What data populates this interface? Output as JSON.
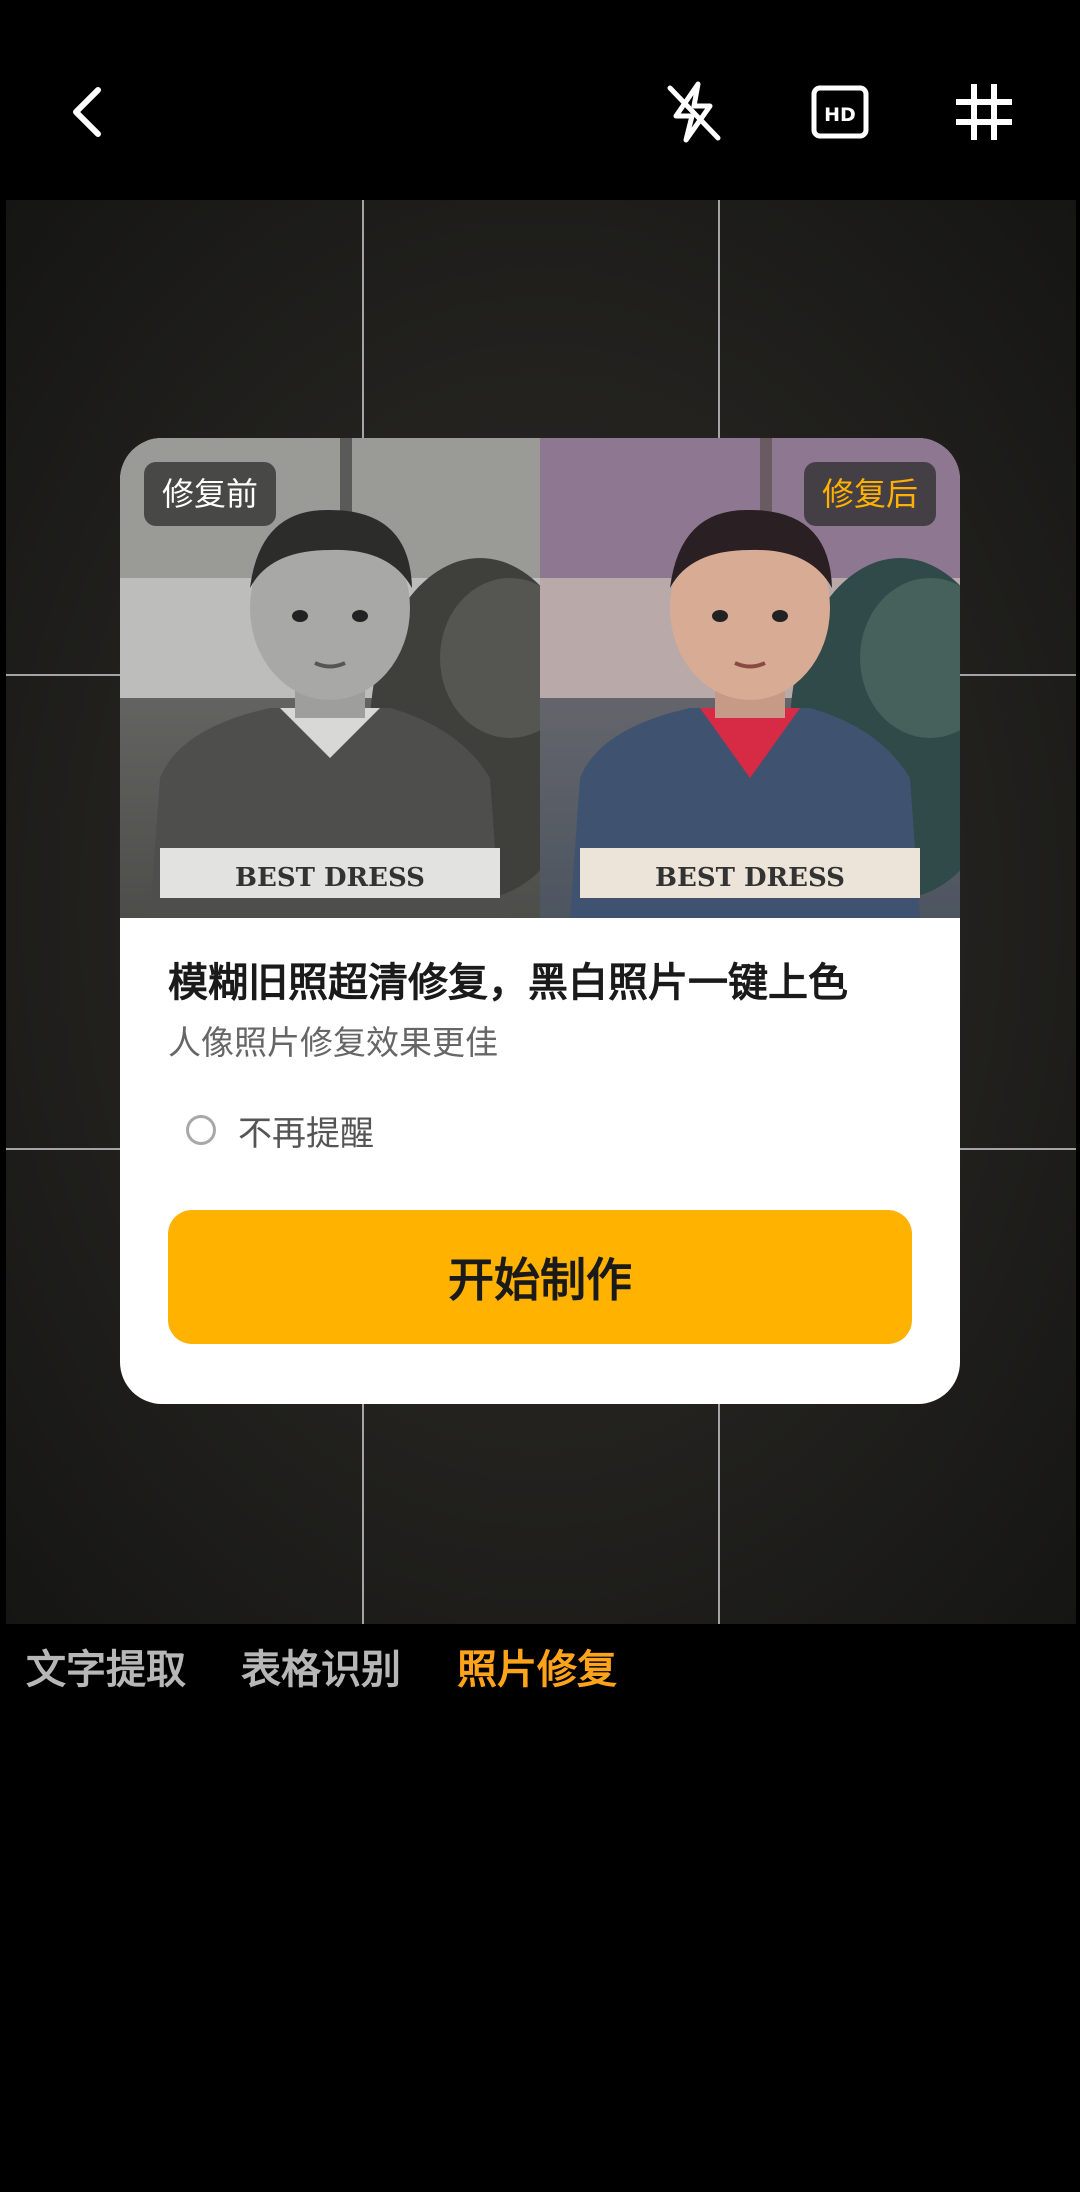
{
  "topbar": {
    "back_icon": "chevron-left-icon",
    "flash_icon": "flash-off-icon",
    "hd_icon": "hd-icon",
    "grid_icon": "grid-icon"
  },
  "card": {
    "before_label": "修复前",
    "after_label": "修复后",
    "title": "模糊旧照超清修复，黑白照片一键上色",
    "subtitle": "人像照片修复效果更佳",
    "dont_remind_label": "不再提醒",
    "start_button_label": "开始制作",
    "shirt_text": "BEST DRESS"
  },
  "modes": [
    {
      "label": "文字提取",
      "active": false
    },
    {
      "label": "表格识别",
      "active": false
    },
    {
      "label": "照片修复",
      "active": true
    }
  ],
  "colors": {
    "accent": "#ffb300",
    "active_tab": "#ffa31a",
    "after_tag": "#ffb000"
  }
}
